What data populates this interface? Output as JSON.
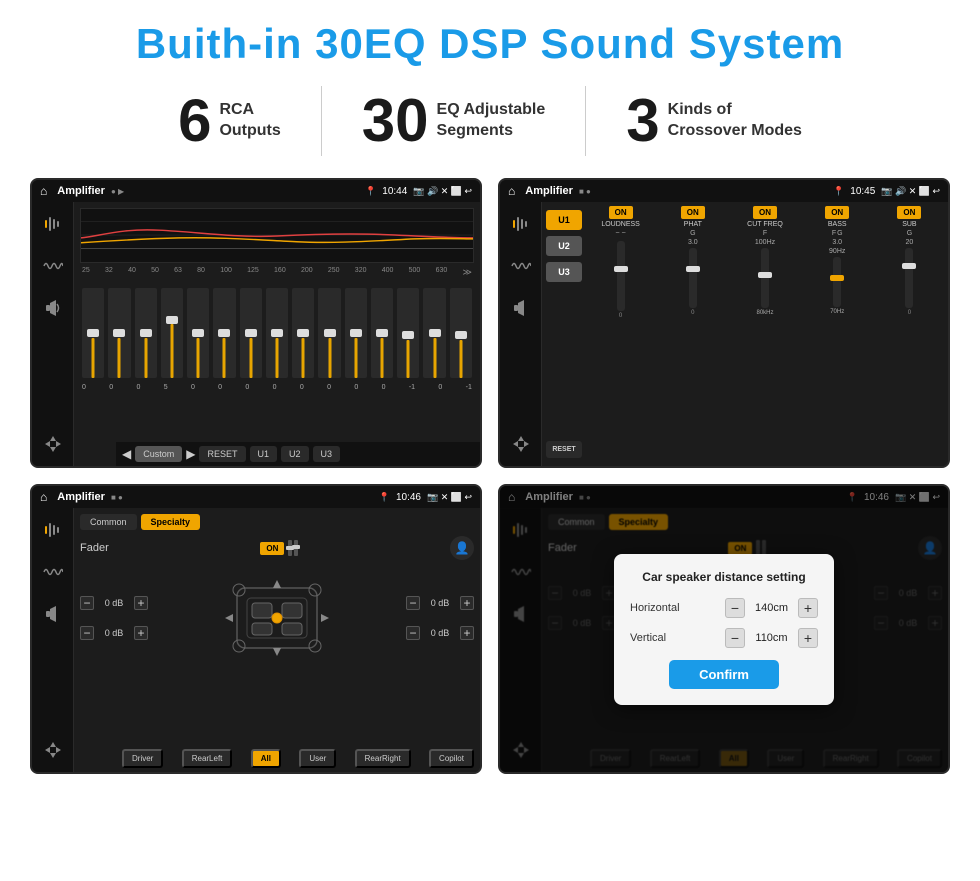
{
  "page": {
    "title": "Buith-in 30EQ DSP Sound System",
    "title_color": "#1a9be8"
  },
  "stats": [
    {
      "number": "6",
      "line1": "RCA",
      "line2": "Outputs"
    },
    {
      "number": "30",
      "line1": "EQ Adjustable",
      "line2": "Segments"
    },
    {
      "number": "3",
      "line1": "Kinds of",
      "line2": "Crossover Modes"
    }
  ],
  "screens": [
    {
      "id": "screen1",
      "title": "Amplifier",
      "time": "10:44",
      "type": "equalizer"
    },
    {
      "id": "screen2",
      "title": "Amplifier",
      "time": "10:45",
      "type": "crossover"
    },
    {
      "id": "screen3",
      "title": "Amplifier",
      "time": "10:46",
      "type": "fader"
    },
    {
      "id": "screen4",
      "title": "Amplifier",
      "time": "10:46",
      "type": "dialog"
    }
  ],
  "eq_labels": [
    "25",
    "32",
    "40",
    "50",
    "63",
    "80",
    "100",
    "125",
    "160",
    "200",
    "250",
    "320",
    "400",
    "500",
    "630"
  ],
  "eq_values": [
    "0",
    "0",
    "0",
    "5",
    "0",
    "0",
    "0",
    "0",
    "0",
    "0",
    "0",
    "0",
    "-1",
    "0",
    "-1"
  ],
  "eq_presets": [
    "Custom",
    "RESET",
    "U1",
    "U2",
    "U3"
  ],
  "crossover": {
    "presets": [
      "U1",
      "U2",
      "U3"
    ],
    "controls": [
      "LOUDNESS",
      "PHAT",
      "CUT FREQ",
      "BASS",
      "SUB"
    ],
    "reset_label": "RESET"
  },
  "fader": {
    "tabs": [
      "Common",
      "Specialty"
    ],
    "fader_label": "Fader",
    "on_label": "ON",
    "left_top_db": "0 dB",
    "left_bot_db": "0 dB",
    "right_top_db": "0 dB",
    "right_bot_db": "0 dB",
    "buttons": [
      "Driver",
      "RearLeft",
      "All",
      "User",
      "RearRight",
      "Copilot"
    ]
  },
  "dialog": {
    "title": "Car speaker distance setting",
    "horizontal_label": "Horizontal",
    "horizontal_value": "140cm",
    "vertical_label": "Vertical",
    "vertical_value": "110cm",
    "confirm_label": "Confirm"
  }
}
